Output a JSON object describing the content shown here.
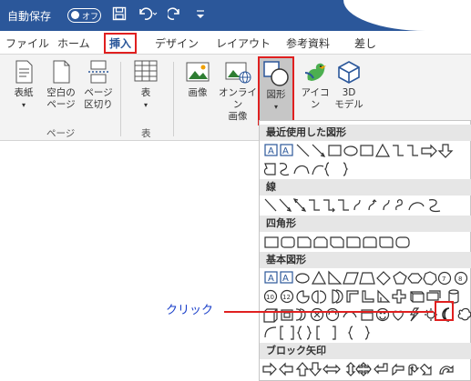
{
  "titlebar": {
    "autosave_label": "自動保存",
    "toggle_state": "オフ"
  },
  "tabs": [
    "ファイル",
    "ホーム",
    "挿入",
    "デザイン",
    "レイアウト",
    "参考資料",
    "差し"
  ],
  "ribbon": {
    "cover": "表紙",
    "blank_page_1": "空白の",
    "blank_page_2": "ページ",
    "page_break_1": "ページ",
    "page_break_2": "区切り",
    "pages_group": "ページ",
    "table": "表",
    "table_group": "表",
    "image": "画像",
    "online_image_1": "オンライン",
    "online_image_2": "画像",
    "shapes": "図形",
    "icons": "アイコン",
    "model_1": "3D",
    "model_2": "モデル"
  },
  "gallery": {
    "recent": "最近使用した図形",
    "lines": "線",
    "rectangles": "四角形",
    "basic": "基本図形",
    "block_arrows": "ブロック矢印"
  },
  "annotation": "クリック",
  "colors": {
    "accent": "#2b579a",
    "highlight": "#e02020",
    "annotation": "#1a3fc9"
  }
}
